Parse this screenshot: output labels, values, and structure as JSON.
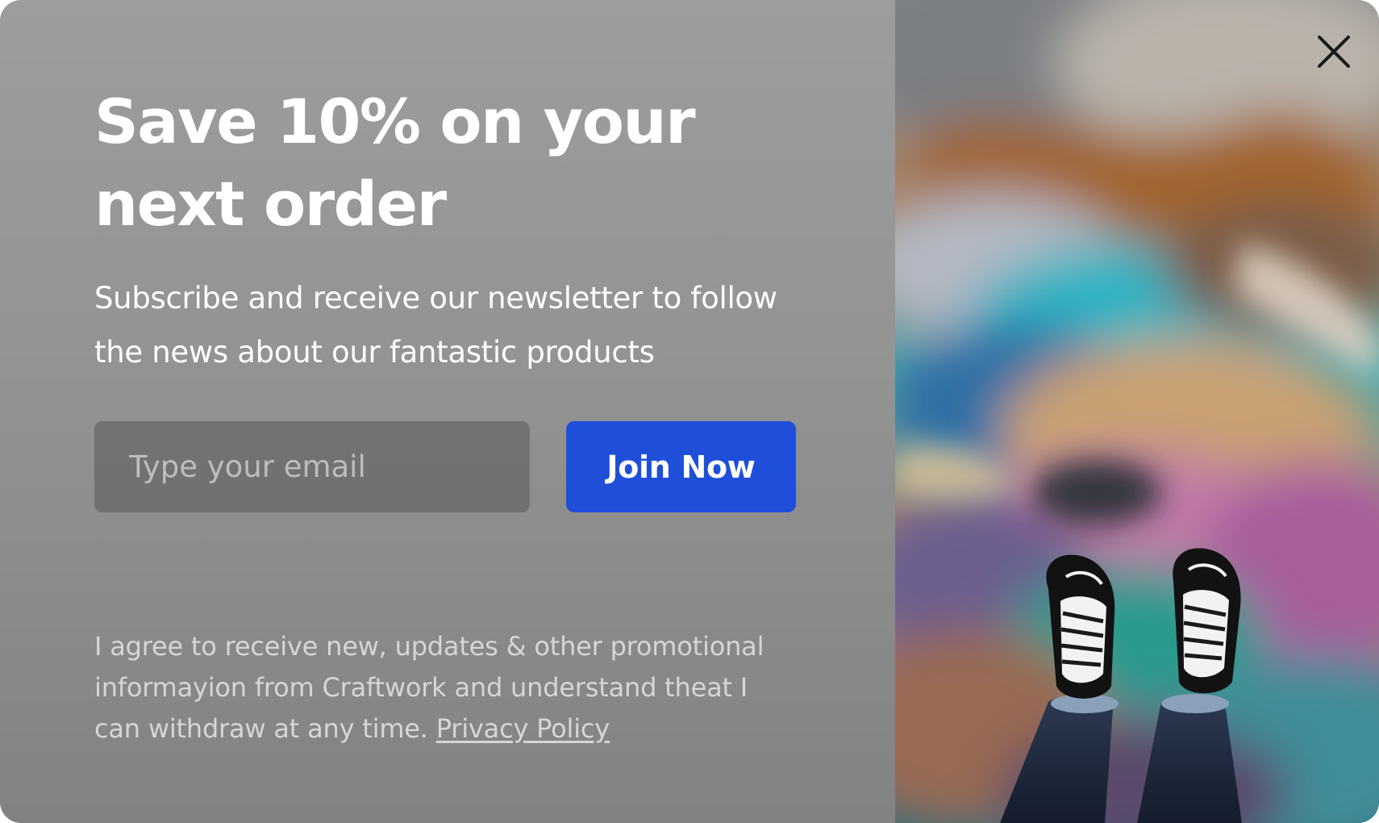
{
  "popup": {
    "headline": "Save 10% on your next order",
    "subtitle": "Subscribe and receive our newsletter to follow the news about our fantastic products",
    "email_placeholder": "Type your email",
    "join_button_label": "Join Now",
    "consent_text": "I agree to receive new, updates & other promotional informayion from Craftwork and understand theat I can withdraw at any time. ",
    "privacy_link_label": "Privacy Policy",
    "close_icon": "close-icon",
    "photo": "oil-slick-sneakers-photo"
  },
  "colors": {
    "accent": "#1f4fd8",
    "panel": "#939393",
    "text": "#ffffff",
    "muted_text": "#d6d6d6"
  }
}
